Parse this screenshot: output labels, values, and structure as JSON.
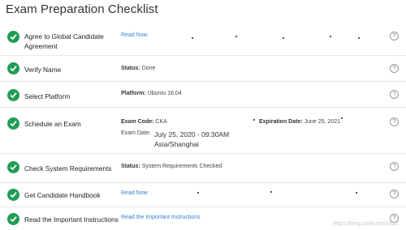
{
  "page_title": "Exam Preparation Checklist",
  "items": [
    {
      "label": "Agree to Global Candidate Agreement",
      "link": "Read Now"
    },
    {
      "label": "Verify Name",
      "status_label": "Status:",
      "status_value": "Done"
    },
    {
      "label": "Select Platform",
      "platform_label": "Platform:",
      "platform_value": "Ubuntu 16.04"
    },
    {
      "label": "Schedule an Exam",
      "exam_code_label": "Exam Code:",
      "exam_code_value": "CKA",
      "expiration_label": "Expiration Date:",
      "expiration_value": "June 25, 2021",
      "exam_date_label": "Exam Date:",
      "exam_date_value": "July 25, 2020 - 09:30AM",
      "timezone": "Asia/Shanghai"
    },
    {
      "label": "Check System Requirements",
      "status_label": "Status:",
      "status_value": "System Requirements Checked"
    },
    {
      "label": "Get Candidate Handbook",
      "link": "Read Now"
    },
    {
      "label": "Read the Important Instructions",
      "link": "Read the Important Instructions"
    }
  ],
  "watermark": "https://blog.csdn.net/zhou"
}
